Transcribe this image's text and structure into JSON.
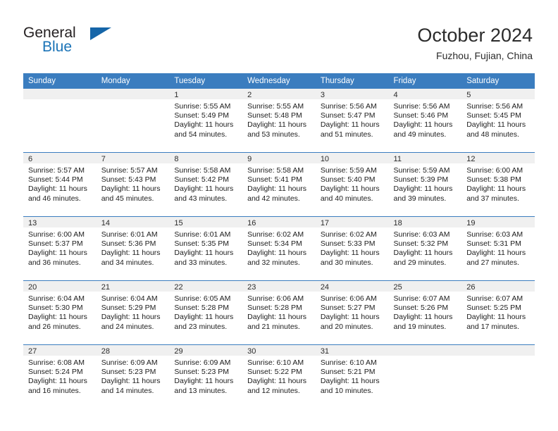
{
  "brand": {
    "name_part1": "General",
    "name_part2": "Blue",
    "logo_icon": "triangle-logo-icon"
  },
  "header": {
    "title": "October 2024",
    "subtitle": "Fuzhou, Fujian, China"
  },
  "colors": {
    "header_blue": "#3b7dbf",
    "brand_blue": "#1a73b7",
    "daynum_band": "#f0f0f0",
    "text": "#1c1c1c"
  },
  "calendar": {
    "weekday_headers": [
      "Sunday",
      "Monday",
      "Tuesday",
      "Wednesday",
      "Thursday",
      "Friday",
      "Saturday"
    ],
    "weeks": [
      [
        {
          "day": "",
          "empty": true
        },
        {
          "day": "",
          "empty": true
        },
        {
          "day": "1",
          "sunrise": "Sunrise: 5:55 AM",
          "sunset": "Sunset: 5:49 PM",
          "daylight": "Daylight: 11 hours and 54 minutes."
        },
        {
          "day": "2",
          "sunrise": "Sunrise: 5:55 AM",
          "sunset": "Sunset: 5:48 PM",
          "daylight": "Daylight: 11 hours and 53 minutes."
        },
        {
          "day": "3",
          "sunrise": "Sunrise: 5:56 AM",
          "sunset": "Sunset: 5:47 PM",
          "daylight": "Daylight: 11 hours and 51 minutes."
        },
        {
          "day": "4",
          "sunrise": "Sunrise: 5:56 AM",
          "sunset": "Sunset: 5:46 PM",
          "daylight": "Daylight: 11 hours and 49 minutes."
        },
        {
          "day": "5",
          "sunrise": "Sunrise: 5:56 AM",
          "sunset": "Sunset: 5:45 PM",
          "daylight": "Daylight: 11 hours and 48 minutes."
        }
      ],
      [
        {
          "day": "6",
          "sunrise": "Sunrise: 5:57 AM",
          "sunset": "Sunset: 5:44 PM",
          "daylight": "Daylight: 11 hours and 46 minutes."
        },
        {
          "day": "7",
          "sunrise": "Sunrise: 5:57 AM",
          "sunset": "Sunset: 5:43 PM",
          "daylight": "Daylight: 11 hours and 45 minutes."
        },
        {
          "day": "8",
          "sunrise": "Sunrise: 5:58 AM",
          "sunset": "Sunset: 5:42 PM",
          "daylight": "Daylight: 11 hours and 43 minutes."
        },
        {
          "day": "9",
          "sunrise": "Sunrise: 5:58 AM",
          "sunset": "Sunset: 5:41 PM",
          "daylight": "Daylight: 11 hours and 42 minutes."
        },
        {
          "day": "10",
          "sunrise": "Sunrise: 5:59 AM",
          "sunset": "Sunset: 5:40 PM",
          "daylight": "Daylight: 11 hours and 40 minutes."
        },
        {
          "day": "11",
          "sunrise": "Sunrise: 5:59 AM",
          "sunset": "Sunset: 5:39 PM",
          "daylight": "Daylight: 11 hours and 39 minutes."
        },
        {
          "day": "12",
          "sunrise": "Sunrise: 6:00 AM",
          "sunset": "Sunset: 5:38 PM",
          "daylight": "Daylight: 11 hours and 37 minutes."
        }
      ],
      [
        {
          "day": "13",
          "sunrise": "Sunrise: 6:00 AM",
          "sunset": "Sunset: 5:37 PM",
          "daylight": "Daylight: 11 hours and 36 minutes."
        },
        {
          "day": "14",
          "sunrise": "Sunrise: 6:01 AM",
          "sunset": "Sunset: 5:36 PM",
          "daylight": "Daylight: 11 hours and 34 minutes."
        },
        {
          "day": "15",
          "sunrise": "Sunrise: 6:01 AM",
          "sunset": "Sunset: 5:35 PM",
          "daylight": "Daylight: 11 hours and 33 minutes."
        },
        {
          "day": "16",
          "sunrise": "Sunrise: 6:02 AM",
          "sunset": "Sunset: 5:34 PM",
          "daylight": "Daylight: 11 hours and 32 minutes."
        },
        {
          "day": "17",
          "sunrise": "Sunrise: 6:02 AM",
          "sunset": "Sunset: 5:33 PM",
          "daylight": "Daylight: 11 hours and 30 minutes."
        },
        {
          "day": "18",
          "sunrise": "Sunrise: 6:03 AM",
          "sunset": "Sunset: 5:32 PM",
          "daylight": "Daylight: 11 hours and 29 minutes."
        },
        {
          "day": "19",
          "sunrise": "Sunrise: 6:03 AM",
          "sunset": "Sunset: 5:31 PM",
          "daylight": "Daylight: 11 hours and 27 minutes."
        }
      ],
      [
        {
          "day": "20",
          "sunrise": "Sunrise: 6:04 AM",
          "sunset": "Sunset: 5:30 PM",
          "daylight": "Daylight: 11 hours and 26 minutes."
        },
        {
          "day": "21",
          "sunrise": "Sunrise: 6:04 AM",
          "sunset": "Sunset: 5:29 PM",
          "daylight": "Daylight: 11 hours and 24 minutes."
        },
        {
          "day": "22",
          "sunrise": "Sunrise: 6:05 AM",
          "sunset": "Sunset: 5:28 PM",
          "daylight": "Daylight: 11 hours and 23 minutes."
        },
        {
          "day": "23",
          "sunrise": "Sunrise: 6:06 AM",
          "sunset": "Sunset: 5:28 PM",
          "daylight": "Daylight: 11 hours and 21 minutes."
        },
        {
          "day": "24",
          "sunrise": "Sunrise: 6:06 AM",
          "sunset": "Sunset: 5:27 PM",
          "daylight": "Daylight: 11 hours and 20 minutes."
        },
        {
          "day": "25",
          "sunrise": "Sunrise: 6:07 AM",
          "sunset": "Sunset: 5:26 PM",
          "daylight": "Daylight: 11 hours and 19 minutes."
        },
        {
          "day": "26",
          "sunrise": "Sunrise: 6:07 AM",
          "sunset": "Sunset: 5:25 PM",
          "daylight": "Daylight: 11 hours and 17 minutes."
        }
      ],
      [
        {
          "day": "27",
          "sunrise": "Sunrise: 6:08 AM",
          "sunset": "Sunset: 5:24 PM",
          "daylight": "Daylight: 11 hours and 16 minutes."
        },
        {
          "day": "28",
          "sunrise": "Sunrise: 6:09 AM",
          "sunset": "Sunset: 5:23 PM",
          "daylight": "Daylight: 11 hours and 14 minutes."
        },
        {
          "day": "29",
          "sunrise": "Sunrise: 6:09 AM",
          "sunset": "Sunset: 5:23 PM",
          "daylight": "Daylight: 11 hours and 13 minutes."
        },
        {
          "day": "30",
          "sunrise": "Sunrise: 6:10 AM",
          "sunset": "Sunset: 5:22 PM",
          "daylight": "Daylight: 11 hours and 12 minutes."
        },
        {
          "day": "31",
          "sunrise": "Sunrise: 6:10 AM",
          "sunset": "Sunset: 5:21 PM",
          "daylight": "Daylight: 11 hours and 10 minutes."
        },
        {
          "day": "",
          "empty": true
        },
        {
          "day": "",
          "empty": true
        }
      ]
    ]
  }
}
